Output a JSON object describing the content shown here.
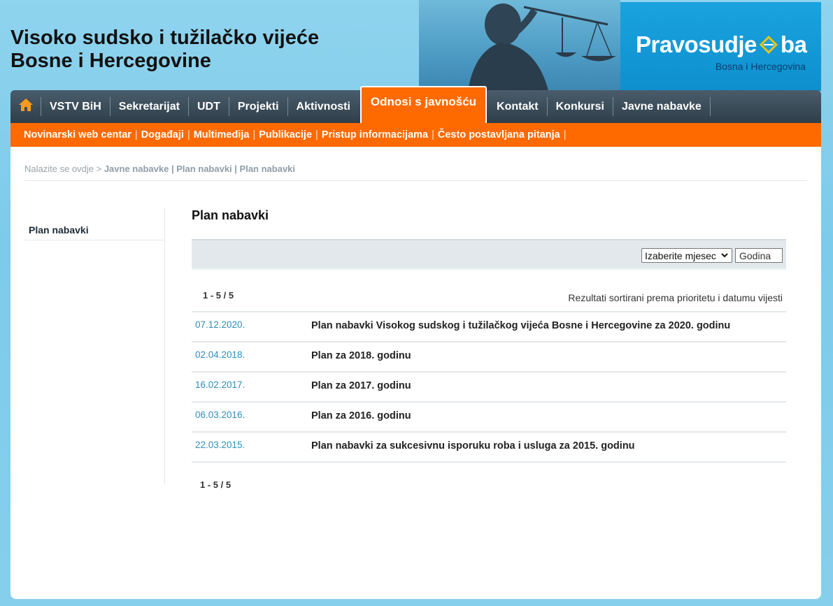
{
  "header": {
    "title_line1": "Visoko sudsko i tužilačko vijeće",
    "title_line2": "Bosne i Hercegovine",
    "logo_left": "Pravosudje",
    "logo_right": "ba",
    "logo_subtitle": "Bosna i Hercegovina"
  },
  "nav": {
    "home_icon": "home-icon",
    "items": [
      {
        "label": "VSTV BiH"
      },
      {
        "label": "Sekretarijat"
      },
      {
        "label": "UDT"
      },
      {
        "label": "Projekti"
      },
      {
        "label": "Aktivnosti"
      },
      {
        "label": "Odnosi s javnošću",
        "active": true
      },
      {
        "label": "Kontakt"
      },
      {
        "label": "Konkursi"
      },
      {
        "label": "Javne nabavke"
      }
    ]
  },
  "subnav": {
    "items": [
      {
        "label": "Novinarski web centar"
      },
      {
        "label": "Događaji"
      },
      {
        "label": "Multimedija"
      },
      {
        "label": "Publikacije"
      },
      {
        "label": "Pristup informacijama"
      },
      {
        "label": "Često postavljana pitanja"
      }
    ],
    "separator": "|"
  },
  "breadcrumb": {
    "prefix": "Nalazite se ovdje >",
    "path": "Javne nabavke | Plan nabavki | Plan nabavki"
  },
  "sidebar": {
    "items": [
      {
        "label": "Plan nabavki"
      }
    ]
  },
  "main": {
    "title": "Plan nabavki",
    "month_select": {
      "selected": "Izaberite mjesec"
    },
    "year_input": {
      "value": "Godina"
    },
    "pager_top": "1 - 5 / 5",
    "sort_note": "Rezultati sortirani prema prioritetu i datumu vijesti",
    "pager_bottom": "1 - 5 / 5",
    "rows": [
      {
        "date": "07.12.2020.",
        "title": "Plan nabavki Visokog sudskog i tužilačkog vijeća Bosne i Hercegovine za 2020. godinu"
      },
      {
        "date": "02.04.2018.",
        "title": "Plan za 2018. godinu"
      },
      {
        "date": "16.02.2017.",
        "title": "Plan za 2017. godinu"
      },
      {
        "date": "06.03.2016.",
        "title": "Plan za 2016. godinu"
      },
      {
        "date": "22.03.2015.",
        "title": "Plan nabavki za sukcesivnu isporuku roba i usluga za 2015. godinu"
      }
    ]
  },
  "colors": {
    "nav_bg": "#34434f",
    "accent_orange": "#ff6a00",
    "link_blue": "#2e8fc0",
    "logo_blue": "#1aa3de"
  }
}
